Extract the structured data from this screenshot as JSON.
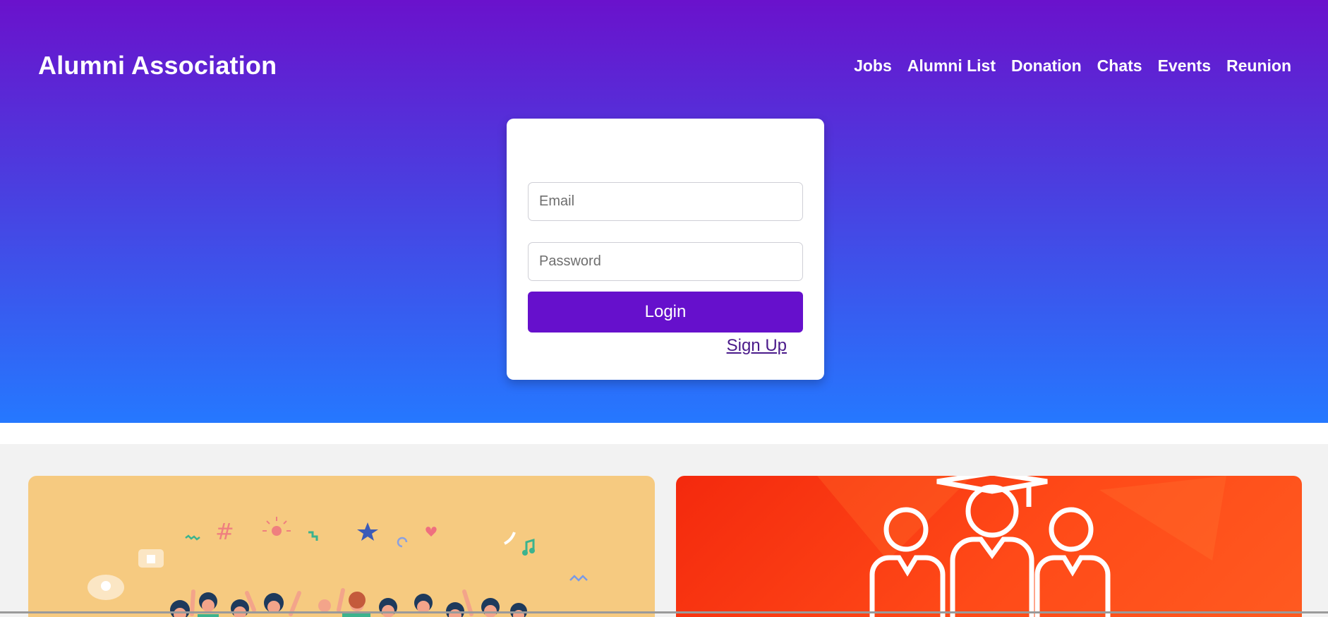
{
  "header": {
    "brand": "Alumni Association",
    "nav": [
      {
        "label": "Jobs"
      },
      {
        "label": "Alumni List"
      },
      {
        "label": "Donation"
      },
      {
        "label": "Chats"
      },
      {
        "label": "Events"
      },
      {
        "label": "Reunion"
      }
    ]
  },
  "login_form": {
    "email": {
      "placeholder": "Email",
      "value": ""
    },
    "password": {
      "placeholder": "Password",
      "value": ""
    },
    "submit_label": "Login",
    "signup_label": "Sign Up"
  },
  "colors": {
    "hero_top": "#6a12cc",
    "hero_bottom": "#2578ff",
    "login_button": "#6610cc",
    "panel_left": "#f6ca80",
    "panel_right": "#f4290d"
  },
  "panels": [
    {
      "image": "crowd-celebration-illustration"
    },
    {
      "image": "graduates-group-icon"
    }
  ]
}
